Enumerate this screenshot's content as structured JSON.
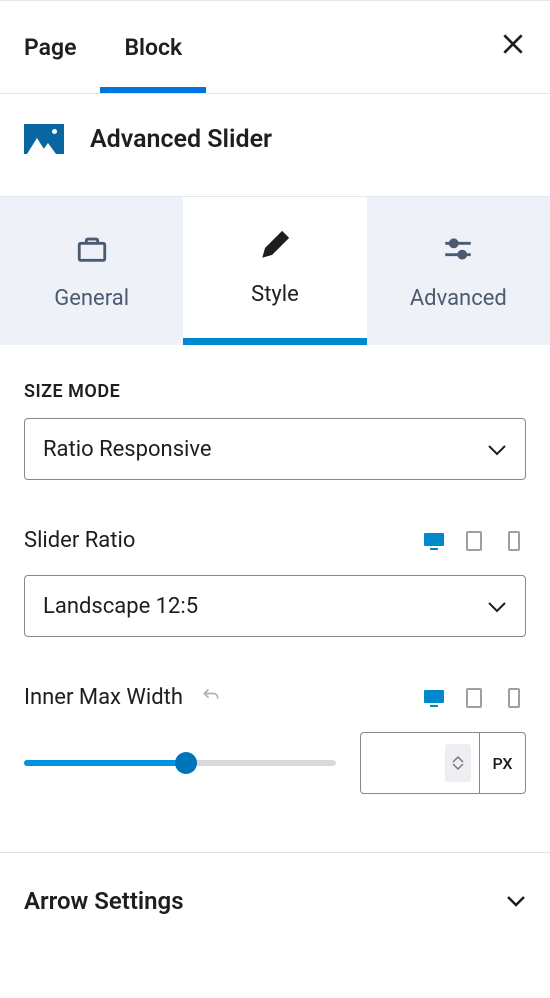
{
  "topTabs": {
    "page": "Page",
    "block": "Block"
  },
  "blockName": "Advanced Slider",
  "subTabs": {
    "general": "General",
    "style": "Style",
    "advanced": "Advanced"
  },
  "sizeMode": {
    "label": "SIZE MODE",
    "value": "Ratio Responsive"
  },
  "sliderRatio": {
    "label": "Slider Ratio",
    "value": "Landscape 12:5"
  },
  "innerMaxWidth": {
    "label": "Inner Max Width",
    "unit": "PX",
    "value": ""
  },
  "arrowSettings": {
    "title": "Arrow Settings"
  }
}
